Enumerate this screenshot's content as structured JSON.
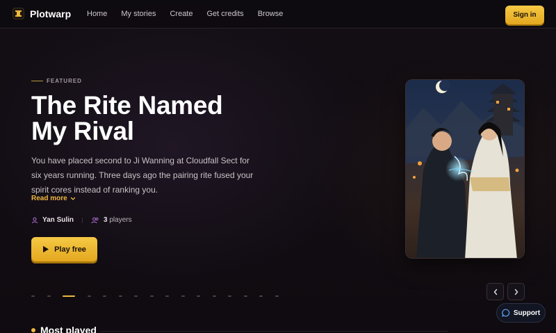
{
  "header": {
    "brand": "Plotwarp",
    "nav": [
      "Home",
      "My stories",
      "Create",
      "Get credits",
      "Browse"
    ],
    "signin_label": "Sign in"
  },
  "hero": {
    "eyebrow": "FEATURED",
    "title_line1": "The Rite Named",
    "title_line2": "My Rival",
    "description": "You have placed second to Ji Wanning at Cloudfall Sect for six years running. Three days ago the pairing rite fused your spirit cores instead of ranking you.",
    "read_more": "Read more",
    "author": "Yan Sulin",
    "players_count": "3",
    "players_label": "players",
    "play_label": "Play free",
    "carousel_slides": 16,
    "carousel_active_index": 2
  },
  "support_label": "Support",
  "section": {
    "title": "Most played"
  },
  "colors": {
    "accent": "#f0b840",
    "background": "#0e0b10"
  }
}
